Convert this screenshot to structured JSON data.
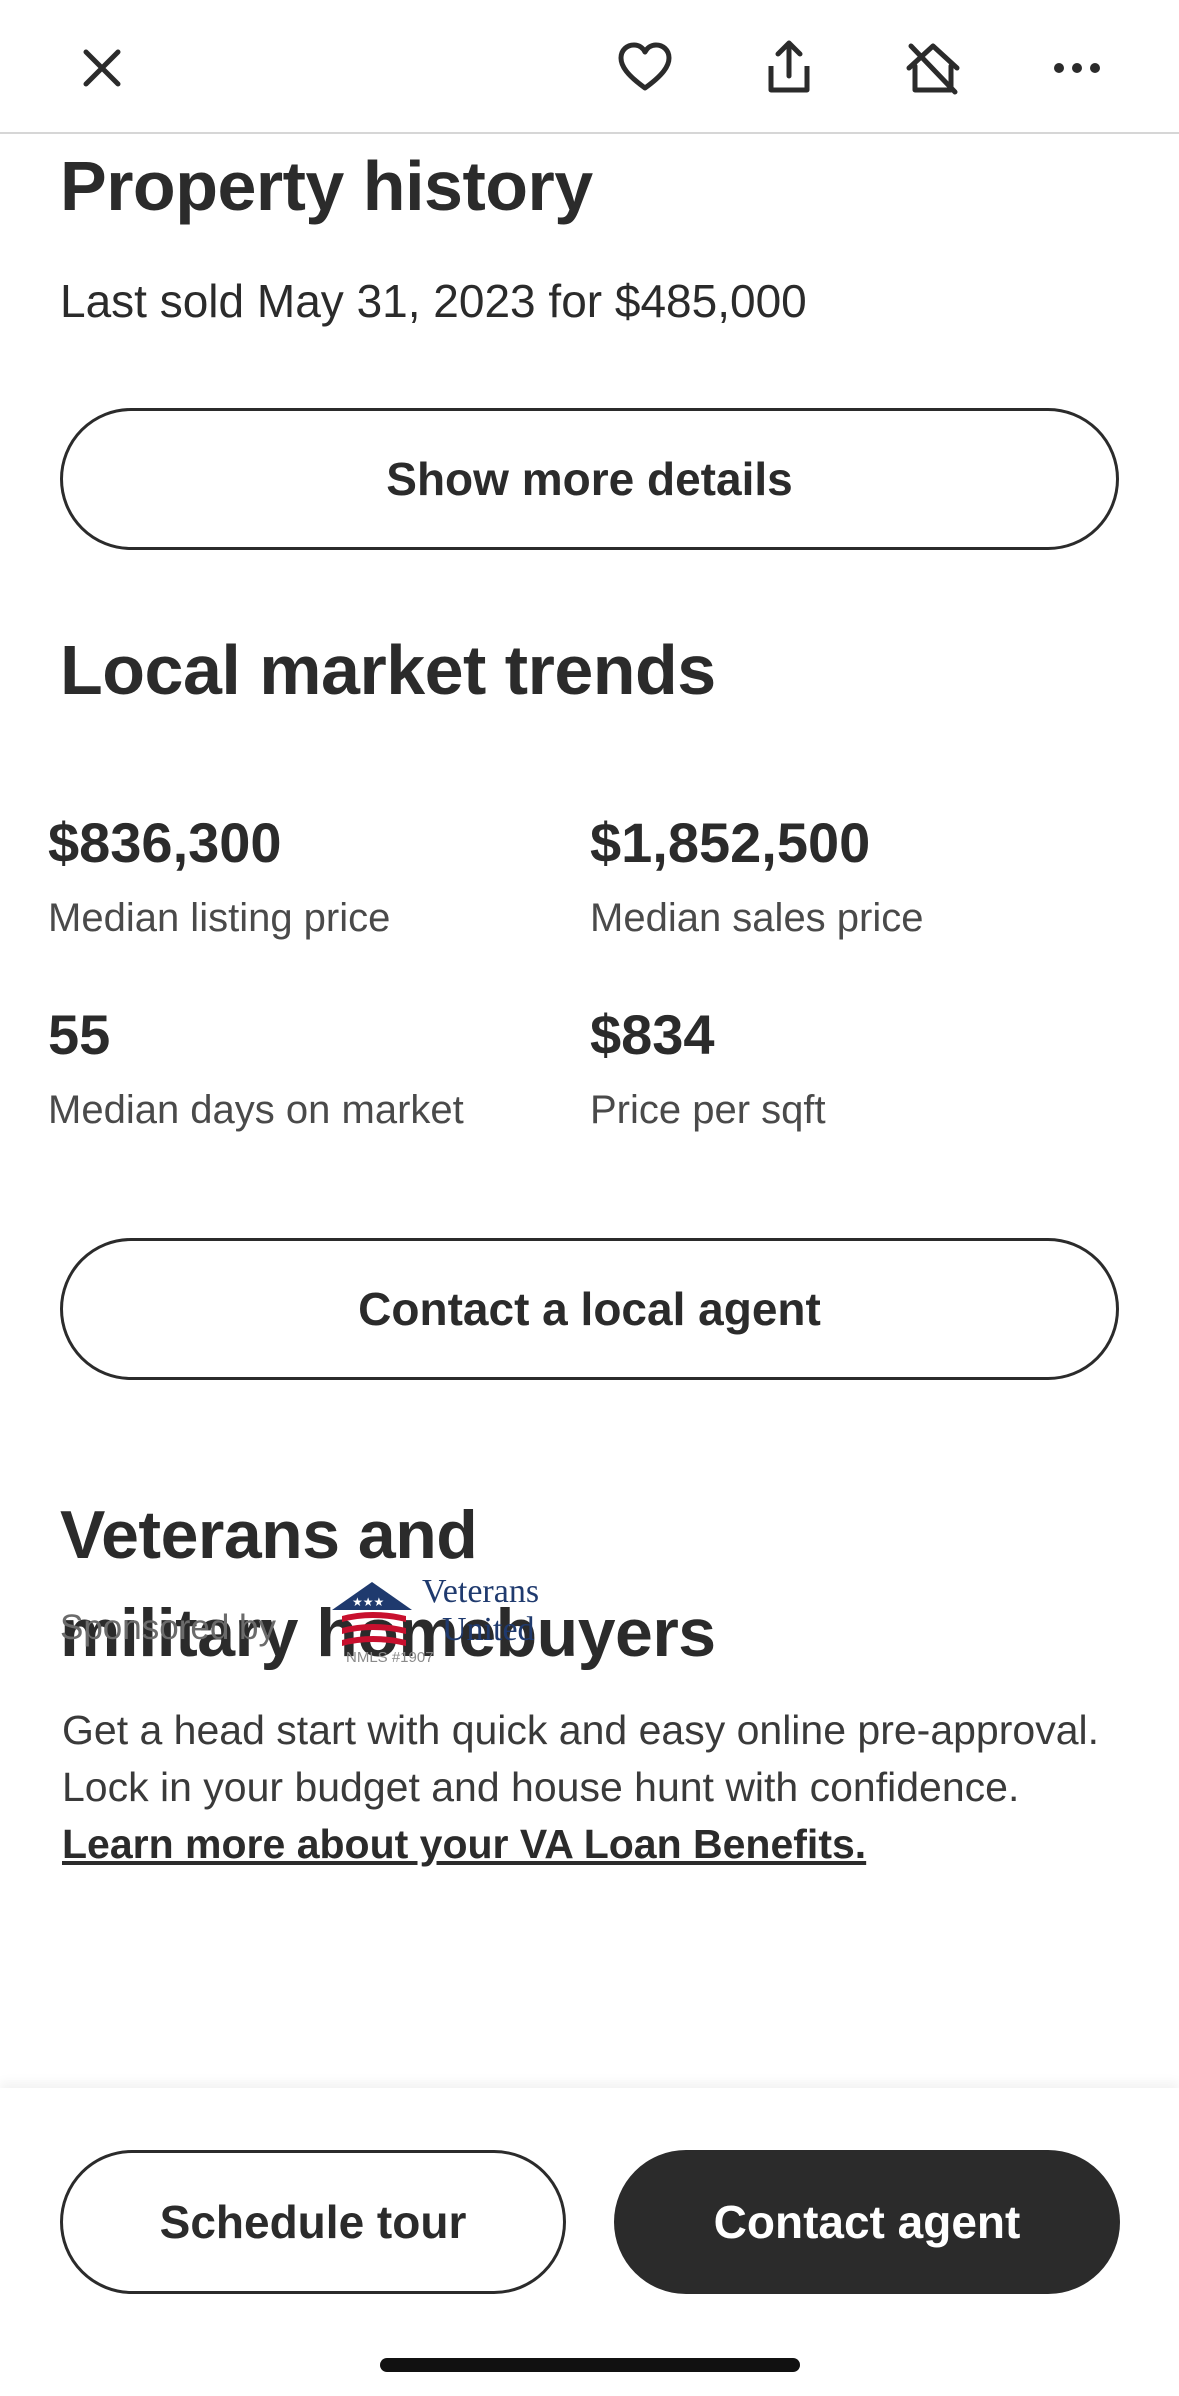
{
  "topbar": {
    "icons": [
      "close-icon",
      "heart-icon",
      "share-icon",
      "hide-home-icon",
      "more-icon"
    ]
  },
  "property_history": {
    "title": "Property history",
    "last_sold": "Last sold May 31, 2023 for $485,000",
    "button_label": "Show more details"
  },
  "market_trends": {
    "title": "Local market trends",
    "stats": [
      {
        "value": "$836,300",
        "label": "Median listing price"
      },
      {
        "value": "$1,852,500",
        "label": "Median sales price"
      },
      {
        "value": "55",
        "label": "Median days on market"
      },
      {
        "value": "$834",
        "label": "Price per sqft"
      }
    ],
    "button_label": "Contact a local agent"
  },
  "veterans": {
    "title_line1": "Veterans and",
    "title_line2": "military homebuyers",
    "sponsored_by": "Sponsored by",
    "logo_text_1": "Veterans",
    "logo_text_2": "United",
    "logo_nmls": "NMLS #1907",
    "paragraph": "Get a head start with quick and easy online pre-approval. Lock in your budget and house hunt with confidence. ",
    "link_text": "Learn more about your VA Loan Benefits."
  },
  "bottom": {
    "schedule_label": "Schedule tour",
    "contact_label": "Contact agent"
  },
  "colors": {
    "text": "#2b2b2b",
    "logo_blue": "#1f3a6e",
    "logo_red": "#c8102e"
  }
}
